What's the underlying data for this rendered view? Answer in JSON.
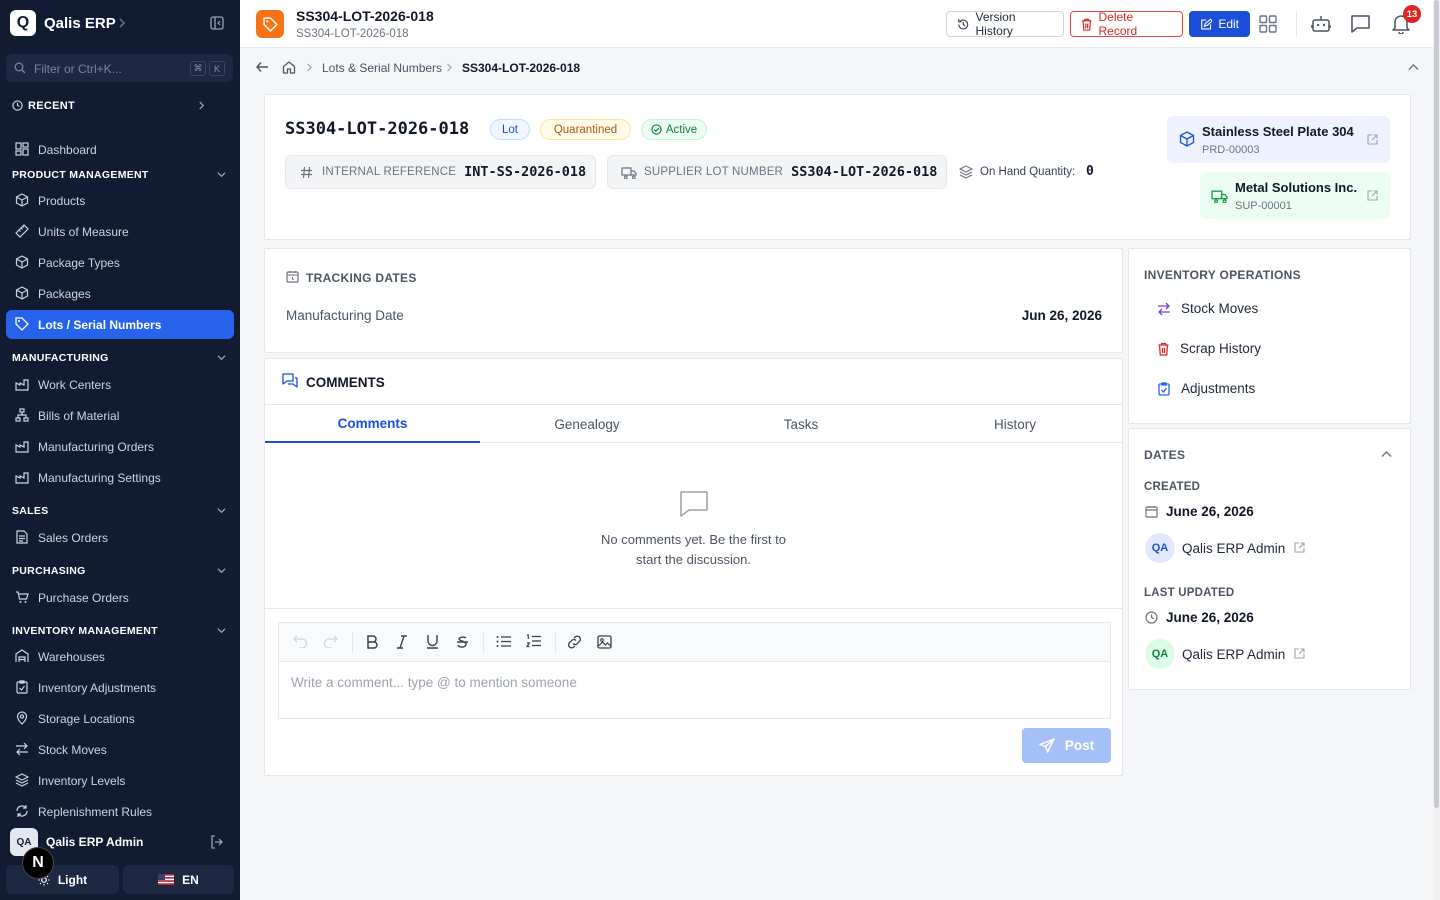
{
  "app": {
    "logo_letter": "Q",
    "name": "Qalis ERP"
  },
  "sidebar": {
    "filter_placeholder": "Filter or Ctrl+K...",
    "kbd": [
      "⌘",
      "K"
    ],
    "recent_label": "RECENT",
    "dashboard": "Dashboard",
    "sections": {
      "product": "PRODUCT MANAGEMENT",
      "manufacturing": "MANUFACTURING",
      "sales": "SALES",
      "purchasing": "PURCHASING",
      "inventory": "INVENTORY MANAGEMENT"
    },
    "items": {
      "products": "Products",
      "uom": "Units of Measure",
      "package_types": "Package Types",
      "packages": "Packages",
      "lots": "Lots / Serial Numbers",
      "work_centers": "Work Centers",
      "bom": "Bills of Material",
      "mo": "Manufacturing Orders",
      "mfg_settings": "Manufacturing Settings",
      "sales_orders": "Sales Orders",
      "purchase_orders": "Purchase Orders",
      "warehouses": "Warehouses",
      "inv_adjustments": "Inventory Adjustments",
      "storage_locations": "Storage Locations",
      "stock_moves": "Stock Moves",
      "inventory_levels": "Inventory Levels",
      "replenishment": "Replenishment Rules"
    },
    "user": {
      "initials": "QA",
      "name": "Qalis ERP Admin"
    },
    "theme_label": "Light",
    "lang_label": "EN",
    "dev_badge": "N"
  },
  "header": {
    "title": "SS304-LOT-2026-018",
    "subtitle": "SS304-LOT-2026-018",
    "version_history": "Version History",
    "delete_record": "Delete Record",
    "edit": "Edit",
    "notifications_count": "13"
  },
  "breadcrumb": {
    "parent": "Lots & Serial Numbers",
    "current": "SS304-LOT-2026-018"
  },
  "record": {
    "title": "SS304-LOT-2026-018",
    "badges": {
      "type": "Lot",
      "quality": "Quarantined",
      "status": "Active"
    },
    "internal_ref_label": "INTERNAL REFERENCE",
    "internal_ref_value": "INT-SS-2026-018",
    "supplier_lot_label": "SUPPLIER LOT NUMBER",
    "supplier_lot_value": "SS304-LOT-2026-018",
    "on_hand_label": "On Hand Quantity:",
    "on_hand_value": "0",
    "product": {
      "name": "Stainless Steel Plate 304",
      "code": "PRD-00003"
    },
    "supplier": {
      "name": "Metal Solutions Inc.",
      "code": "SUP-00001"
    }
  },
  "tracking": {
    "heading": "TRACKING DATES",
    "mfg_label": "Manufacturing Date",
    "mfg_value": "Jun 26, 2026"
  },
  "comments": {
    "heading": "COMMENTS",
    "tabs": [
      "Comments",
      "Genealogy",
      "Tasks",
      "History"
    ],
    "active_tab": "Comments",
    "empty_line1": "No comments yet. Be the first to",
    "empty_line2": "start the discussion.",
    "placeholder": "Write a comment... type @ to mention someone",
    "post": "Post"
  },
  "inventory_ops": {
    "heading": "INVENTORY OPERATIONS",
    "items": [
      "Stock Moves",
      "Scrap History",
      "Adjustments"
    ]
  },
  "dates": {
    "heading": "DATES",
    "created_label": "CREATED",
    "created_value": "June 26, 2026",
    "created_by_initials": "QA",
    "created_by": "Qalis ERP Admin",
    "updated_label": "LAST UPDATED",
    "updated_value": "June 26, 2026",
    "updated_by_initials": "QA",
    "updated_by": "Qalis ERP Admin"
  },
  "colors": {
    "sidebar_bg": "#111c33",
    "accent": "#2563eb",
    "record_icon": "#f97316",
    "danger": "#dc2626",
    "warning": "#b45309",
    "success": "#15803d"
  }
}
